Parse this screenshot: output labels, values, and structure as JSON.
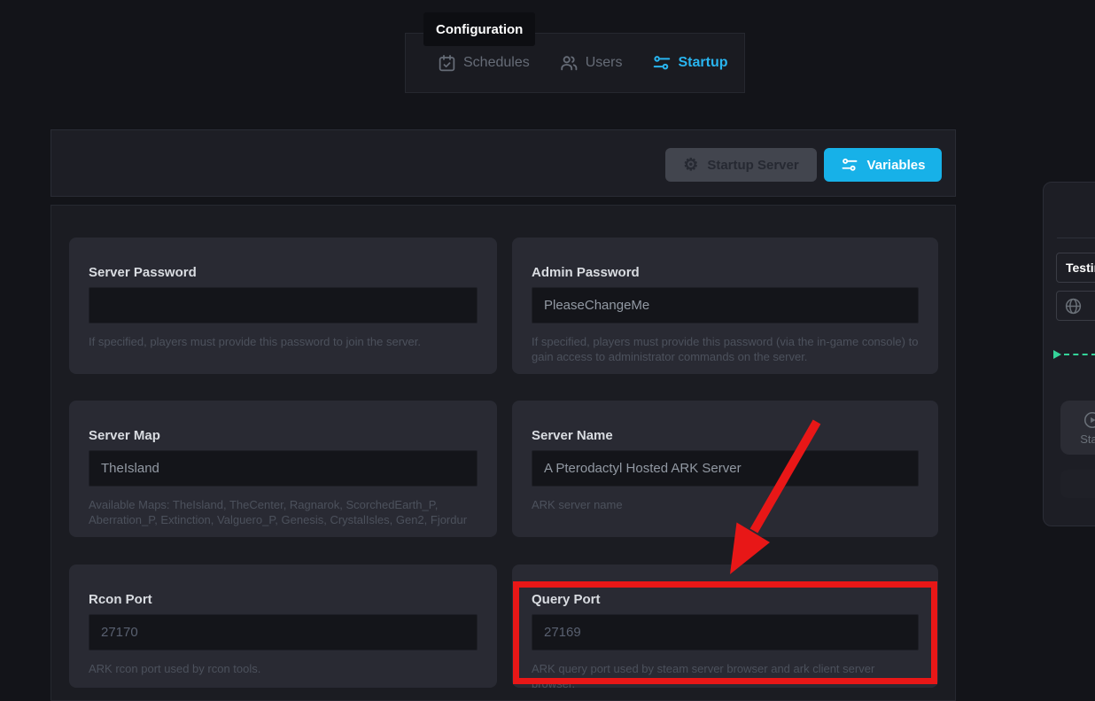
{
  "colors": {
    "accent_cyan": "#17b1e8",
    "tab_active_cyan": "#29b5f0",
    "highlight_red": "#e81717",
    "status_green": "#34d399"
  },
  "tooltip": {
    "label": "Configuration"
  },
  "tabs": [
    {
      "label": "Schedules",
      "icon": "calendar-check-icon",
      "active": false
    },
    {
      "label": "Users",
      "icon": "users-icon",
      "active": false
    },
    {
      "label": "Startup",
      "icon": "sliders-icon",
      "active": true
    }
  ],
  "toolbar": {
    "startup_server_label": "Startup Server",
    "variables_label": "Variables"
  },
  "form": {
    "cards": [
      {
        "label": "Server Password",
        "value": "",
        "help": "If specified, players must provide this password to join the server."
      },
      {
        "label": "Admin Password",
        "value": "PleaseChangeMe",
        "help": "If specified, players must provide this password (via the in-game console) to gain access to administrator commands on the server."
      },
      {
        "label": "Server Map",
        "value": "TheIsland",
        "help": "Available Maps: TheIsland, TheCenter, Ragnarok, ScorchedEarth_P, Aberration_P, Extinction, Valguero_P, Genesis, CrystalIsles, Gen2, Fjordur"
      },
      {
        "label": "Server Name",
        "value": "A Pterodactyl Hosted ARK Server",
        "help": "ARK server name"
      },
      {
        "label": "Rcon Port",
        "value": "27170",
        "help": "ARK rcon port used by rcon tools."
      },
      {
        "label": "Query Port",
        "value": "27169",
        "help": "ARK query port used by steam server browser and ark client server browser.",
        "highlighted": true
      }
    ]
  },
  "side_panel": {
    "server_name": "Testin",
    "start_label": "Start"
  }
}
